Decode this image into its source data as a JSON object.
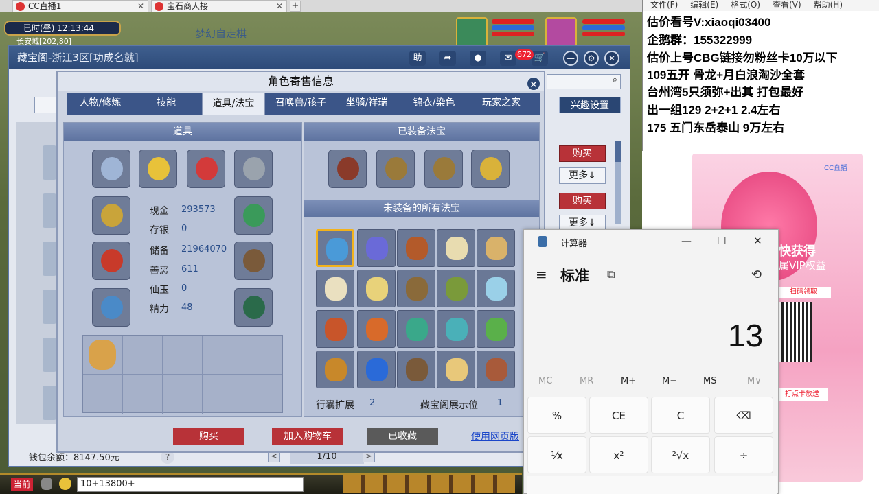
{
  "browser_tabs": [
    {
      "label": "CC直播1"
    },
    {
      "label": "宝石商人接"
    }
  ],
  "game": {
    "time": "已时(昼)  12:13:44",
    "map": "长安城[202,80]",
    "scene_title": "梦幻自走棋"
  },
  "main_window": {
    "title": "藏宝阁-浙江3区[功成名就]",
    "help_label": "助",
    "cart_badge": "672",
    "wallet": "钱包余额：8147.50元",
    "page": "1/10",
    "prev": "<",
    "next": ">",
    "help_q": "?",
    "side_buttons": [
      {
        "buy": "购买",
        "more": "更多↓"
      },
      {
        "buy": "购买",
        "more": "更多↓"
      }
    ]
  },
  "dialog": {
    "title": "角色寄售信息",
    "tabs": [
      "人物/修炼",
      "技能",
      "道具/法宝",
      "召唤兽/孩子",
      "坐骑/祥瑞",
      "锦衣/染色",
      "玩家之家"
    ],
    "active_tab": 2,
    "interest_button": "兴趣设置",
    "items_panel_title": "道具",
    "equipped_title": "已装备法宝",
    "unequipped_title": "未装备的所有法宝",
    "stats": [
      {
        "label": "现金",
        "value": "293573"
      },
      {
        "label": "存银",
        "value": "0"
      },
      {
        "label": "储备",
        "value": "21964070"
      },
      {
        "label": "善恶",
        "value": "611"
      },
      {
        "label": "仙玉",
        "value": "0"
      },
      {
        "label": "精力",
        "value": "48"
      }
    ],
    "bag_ext_label": "行囊扩展",
    "bag_ext_value": "2",
    "showcase_label": "藏宝阁展示位",
    "showcase_value": "1",
    "buy": "购买",
    "add_cart": "加入购物车",
    "collected": "已收藏",
    "web_link": "使用网页版"
  },
  "chat": {
    "current_label": "当前",
    "input_value": "10+13800+"
  },
  "notepad": {
    "menu": [
      "文件(F)",
      "编辑(E)",
      "格式(O)",
      "查看(V)",
      "帮助(H)"
    ],
    "lines": [
      "估价看号V:xiaoqi03400",
      "企鹅群：155322999",
      "估价上号CBG链接勿粉丝卡10万以下",
      "109五开 骨龙+月白浪淘沙全套",
      "台州湾5只须弥+出其 打包最好",
      "出一组129 2+2+1   2.4左右",
      "175 五门东岳泰山  9万左右"
    ]
  },
  "ad": {
    "brand": "CC直播",
    "title": "快获得",
    "subtitle": "属VIP权益",
    "scan": "扫码领取",
    "card": "打点卡放送"
  },
  "calculator": {
    "title": "计算器",
    "mode": "标准",
    "display": "13",
    "memory": [
      "MC",
      "MR",
      "M+",
      "M−",
      "MS",
      "M∨"
    ],
    "keys_row1": [
      "%",
      "CE",
      "C",
      "⌫"
    ],
    "keys_row2": [
      "¹⁄x",
      "x²",
      "²√x",
      "÷"
    ],
    "minimize": "—",
    "maximize": "☐",
    "close": "✕",
    "menu_icon": "≡",
    "history_icon": "⟲",
    "keep_on_top_icon": "⧉"
  },
  "colors": {
    "buy_red": "#b83238",
    "window_blue": "#2d4a78",
    "highlight_gold": "#f2b21c"
  }
}
